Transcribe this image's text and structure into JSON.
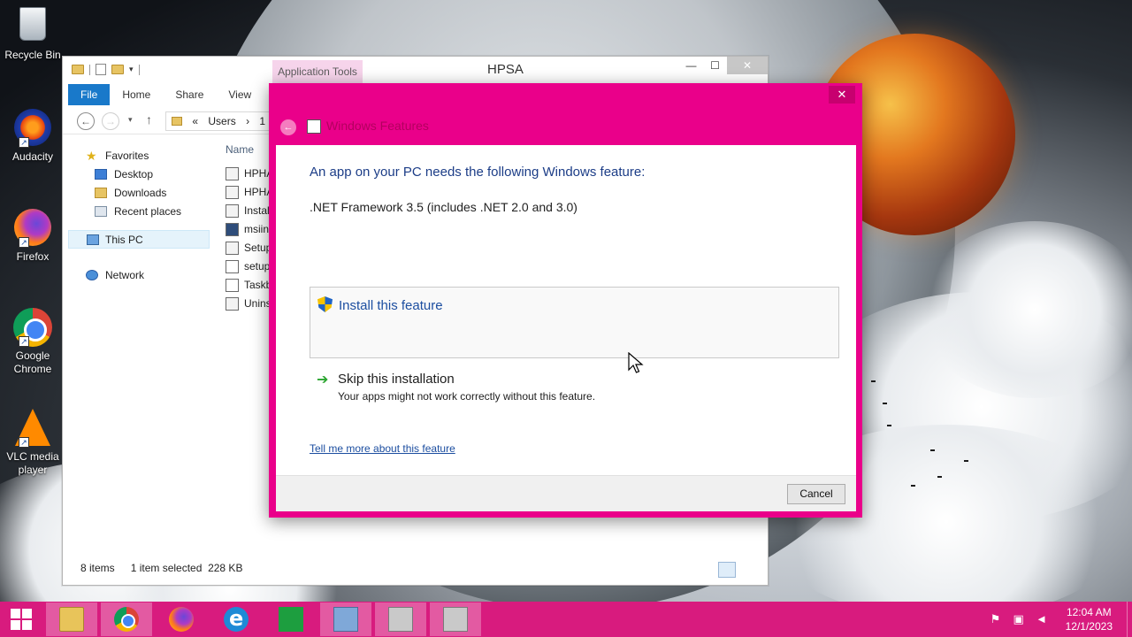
{
  "desktop": {
    "icons": [
      {
        "label": "Recycle Bin",
        "icon": "recycle-bin-icon"
      },
      {
        "label": "Audacity",
        "icon": "audacity-icon"
      },
      {
        "label": "Firefox",
        "icon": "firefox-icon"
      },
      {
        "label": "Google Chrome",
        "icon": "chrome-icon"
      },
      {
        "label": "VLC media player",
        "icon": "vlc-icon"
      }
    ]
  },
  "explorer": {
    "contextual_tab": "Application Tools",
    "title": "HPSA",
    "caption": {
      "minimize": "—",
      "maximize": "☐",
      "close": "✕"
    },
    "ribbon_tabs": [
      "File",
      "Home",
      "Share",
      "View"
    ],
    "address": {
      "chevrons": "«",
      "crumbs": [
        "Users",
        "1",
        "›"
      ]
    },
    "nav": {
      "favorites": "Favorites",
      "favorites_items": [
        "Desktop",
        "Downloads",
        "Recent places"
      ],
      "this_pc": "This PC",
      "network": "Network"
    },
    "column_name": "Name",
    "files": [
      "HPHA",
      "HPHA",
      "Instal",
      "msiin",
      "Setup",
      "setup",
      "Taskb",
      "Unins"
    ],
    "status": {
      "items": "8 items",
      "selection": "1 item selected",
      "size": "228 KB"
    }
  },
  "dialog": {
    "close_glyph": "✕",
    "back_glyph": "←",
    "title": "Windows Features",
    "headline": "An app on your PC needs the following Windows feature:",
    "feature_name": ".NET Framework 3.5 (includes .NET 2.0 and 3.0)",
    "install_label": "Install this feature",
    "skip_label": "Skip this installation",
    "skip_desc": "Your apps might not work correctly without this feature.",
    "more_link": "Tell me more about this feature",
    "cancel_label": "Cancel",
    "accent_color": "#ea008a"
  },
  "taskbar": {
    "color": "#d81b7e",
    "apps": [
      "File Explorer",
      "Google Chrome",
      "Firefox",
      "Internet Explorer",
      "Store",
      "Control Panel",
      "Setup",
      "Setup"
    ],
    "clock_time": "12:04 AM",
    "clock_date": "12/1/2023"
  }
}
